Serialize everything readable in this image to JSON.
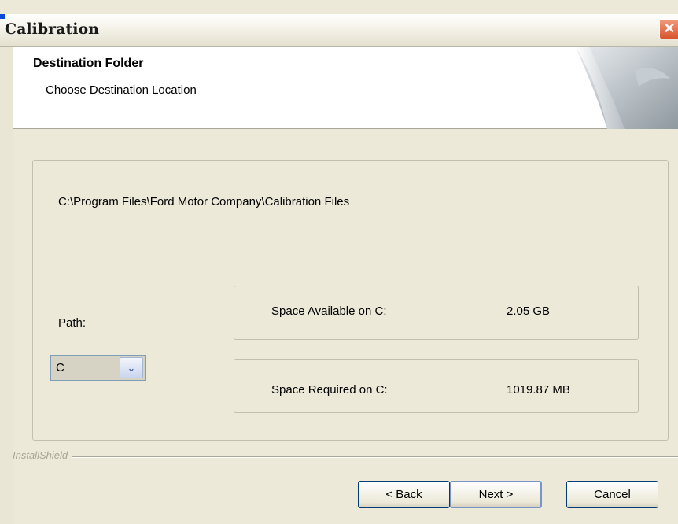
{
  "window": {
    "title": "Calibration",
    "close_glyph": "✕"
  },
  "header": {
    "title": "Destination Folder",
    "subtitle": "Choose Destination Location"
  },
  "destination": {
    "path": "C:\\Program Files\\Ford Motor Company\\Calibration Files"
  },
  "drive": {
    "label": "Path:",
    "selected": "C",
    "arrow_glyph": "⌄"
  },
  "space": {
    "available_label": "Space Available on C:",
    "available_value": "2.05 GB",
    "required_label": "Space Required on C:",
    "required_value": "1019.87 MB"
  },
  "footer": {
    "brand": "InstallShield"
  },
  "buttons": {
    "back": "< Back",
    "next": "Next >",
    "cancel": "Cancel"
  },
  "colors": {
    "dialog_bg": "#ece9d8",
    "titlebar_accent": "#0a4ad8",
    "close_button": "#d9542c",
    "button_border": "#003c74"
  }
}
